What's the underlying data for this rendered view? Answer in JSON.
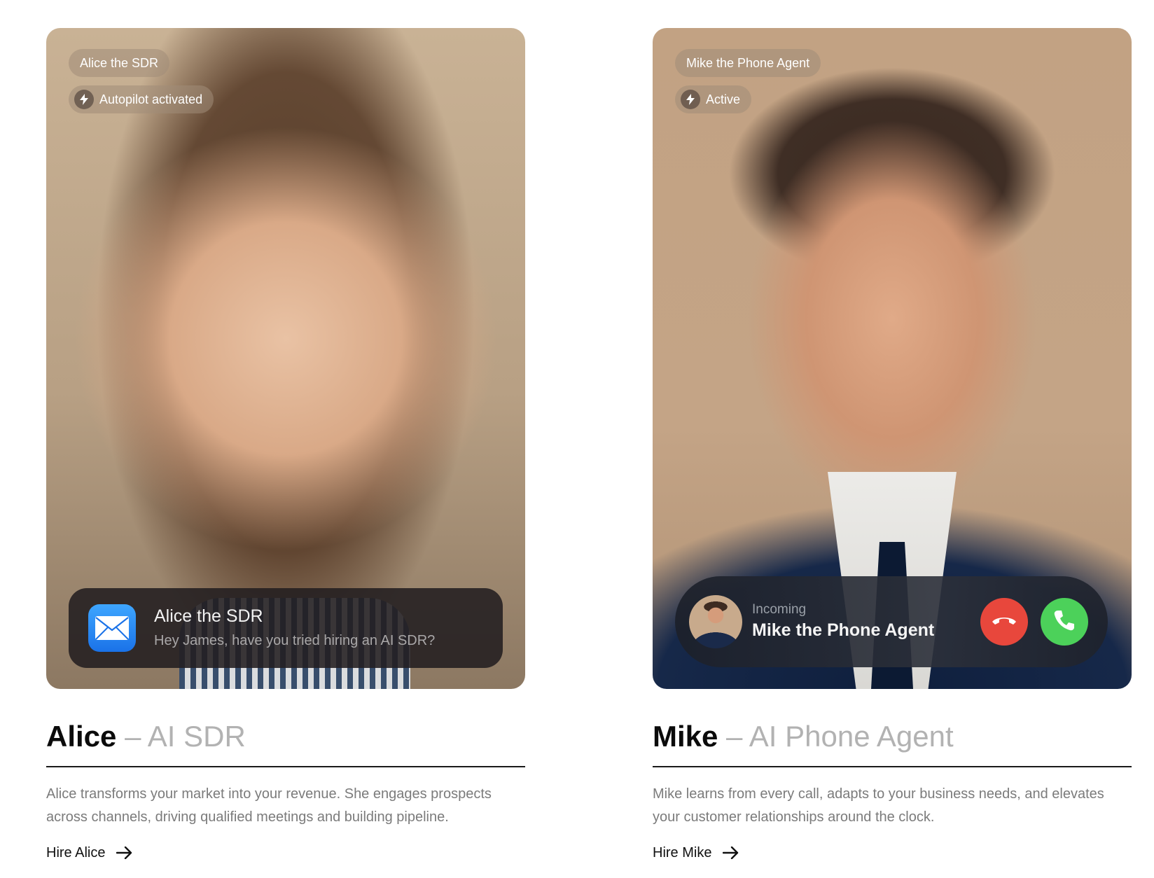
{
  "agents": {
    "alice": {
      "name_chip": "Alice the SDR",
      "status_chip": "Autopilot activated",
      "notification": {
        "app_icon": "mail-icon",
        "title": "Alice the SDR",
        "body": "Hey James, have you tried hiring an AI SDR?"
      },
      "name": "Alice",
      "role": "– AI SDR",
      "description": "Alice transforms your market into your revenue. She engages prospects across channels, driving qualified meetings and building pipeline.",
      "cta": "Hire Alice"
    },
    "mike": {
      "name_chip": "Mike the Phone Agent",
      "status_chip": "Active",
      "call": {
        "label": "Incoming",
        "caller": "Mike the Phone Agent",
        "decline_icon": "phone-hangup-icon",
        "accept_icon": "phone-icon"
      },
      "name": "Mike",
      "role": "– AI Phone Agent",
      "description": "Mike learns from every call, adapts to your business needs, and elevates your customer relationships around the clock.",
      "cta": "Hire Mike"
    }
  },
  "colors": {
    "decline": "#e8473c",
    "accept": "#4cd15a",
    "mail_icon": "#1a72e8",
    "role_text": "#b2b2b2",
    "description_text": "#7b7b7b"
  }
}
